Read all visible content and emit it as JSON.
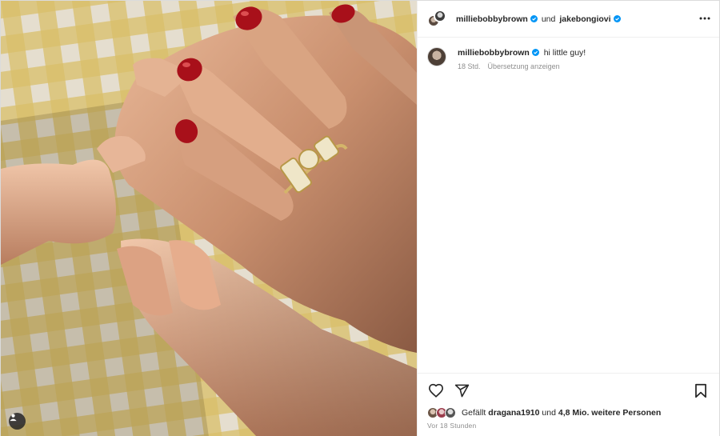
{
  "header": {
    "author": "milliebobbybrown",
    "connector": "und",
    "collaborator": "jakebongiovi",
    "more_icon": "more-horizontal-icon"
  },
  "caption": {
    "author": "milliebobbybrown",
    "text": "hi little guy!",
    "age": "18 Std.",
    "translate": "Übersetzung anzeigen"
  },
  "actions": {
    "icons": [
      "heart-icon",
      "share-icon",
      "bookmark-icon"
    ]
  },
  "likes": {
    "prefix": "Gefällt",
    "user": "dragana1910",
    "middle": "und",
    "count": "4,8 Mio. weitere Personen"
  },
  "timestamp": "Vor 18 Stunden",
  "media": {
    "ring_text": "MOM",
    "tag_icon": "user-tag-icon"
  },
  "colors": {
    "verified": "#0095f6",
    "text": "#262626",
    "secondary": "#8e8e8e",
    "nail": "#a8101a",
    "gingham_yellow": "#e8d07a"
  }
}
